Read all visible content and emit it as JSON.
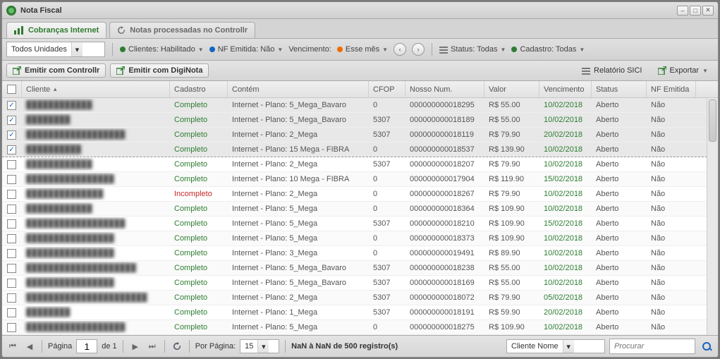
{
  "window": {
    "title": "Nota Fiscal"
  },
  "tabs": {
    "active": "Cobranças Internet",
    "inactive": "Notas processadas no Controllr"
  },
  "filters": {
    "unidade": "Todos Unidades",
    "clientes": "Clientes: Habilitado",
    "nf": "NF Emitida: Não",
    "venc_label": "Vencimento:",
    "venc_value": "Esse mês",
    "status": "Status: Todas",
    "cadastro": "Cadastro: Todas"
  },
  "toolbar": {
    "emitir_controllr": "Emitir com Controllr",
    "emitir_diginota": "Emitir com DigiNota",
    "relatorio": "Relatório SICI",
    "exportar": "Exportar"
  },
  "columns": {
    "cliente": "Cliente",
    "cadastro": "Cadastro",
    "contem": "Contém",
    "cfop": "CFOP",
    "nosso": "Nosso Num.",
    "valor": "Valor",
    "vencimento": "Vencimento",
    "status": "Status",
    "nf": "NF Emitida"
  },
  "rows": [
    {
      "chk": true,
      "cliente": "████████████",
      "cad": "Completo",
      "cad_ok": true,
      "contem": "Internet - Plano: 5_Mega_Bavaro",
      "cfop": "0",
      "num": "000000000018295",
      "valor": "R$ 55.00",
      "venc": "10/02/2018",
      "status": "Aberto",
      "nf": "Não"
    },
    {
      "chk": true,
      "cliente": "████████",
      "cad": "Completo",
      "cad_ok": true,
      "contem": "Internet - Plano: 5_Mega_Bavaro",
      "cfop": "5307",
      "num": "000000000018189",
      "valor": "R$ 55.00",
      "venc": "10/02/2018",
      "status": "Aberto",
      "nf": "Não"
    },
    {
      "chk": true,
      "cliente": "██████████████████",
      "cad": "Completo",
      "cad_ok": true,
      "contem": "Internet - Plano: 2_Mega",
      "cfop": "5307",
      "num": "000000000018119",
      "valor": "R$ 79.90",
      "venc": "20/02/2018",
      "status": "Aberto",
      "nf": "Não"
    },
    {
      "chk": true,
      "cliente": "██████████",
      "cad": "Completo",
      "cad_ok": true,
      "contem": "Internet - Plano: 15 Mega - FIBRA",
      "cfop": "0",
      "num": "000000000018537",
      "valor": "R$ 139.90",
      "venc": "10/02/2018",
      "status": "Aberto",
      "nf": "Não",
      "dashed": true
    },
    {
      "chk": false,
      "cliente": "████████████",
      "cad": "Completo",
      "cad_ok": true,
      "contem": "Internet - Plano: 2_Mega",
      "cfop": "5307",
      "num": "000000000018207",
      "valor": "R$ 79.90",
      "venc": "10/02/2018",
      "status": "Aberto",
      "nf": "Não"
    },
    {
      "chk": false,
      "cliente": "████████████████",
      "cad": "Completo",
      "cad_ok": true,
      "contem": "Internet - Plano: 10 Mega - FIBRA",
      "cfop": "0",
      "num": "000000000017904",
      "valor": "R$ 119.90",
      "venc": "15/02/2018",
      "status": "Aberto",
      "nf": "Não"
    },
    {
      "chk": false,
      "cliente": "██████████████",
      "cad": "Incompleto",
      "cad_ok": false,
      "contem": "Internet - Plano: 2_Mega",
      "cfop": "0",
      "num": "000000000018267",
      "valor": "R$ 79.90",
      "venc": "10/02/2018",
      "status": "Aberto",
      "nf": "Não"
    },
    {
      "chk": false,
      "cliente": "████████████",
      "cad": "Completo",
      "cad_ok": true,
      "contem": "Internet - Plano: 5_Mega",
      "cfop": "0",
      "num": "000000000018364",
      "valor": "R$ 109.90",
      "venc": "10/02/2018",
      "status": "Aberto",
      "nf": "Não"
    },
    {
      "chk": false,
      "cliente": "██████████████████",
      "cad": "Completo",
      "cad_ok": true,
      "contem": "Internet - Plano: 5_Mega",
      "cfop": "5307",
      "num": "000000000018210",
      "valor": "R$ 109.90",
      "venc": "15/02/2018",
      "status": "Aberto",
      "nf": "Não"
    },
    {
      "chk": false,
      "cliente": "████████████████",
      "cad": "Completo",
      "cad_ok": true,
      "contem": "Internet - Plano: 5_Mega",
      "cfop": "0",
      "num": "000000000018373",
      "valor": "R$ 109.90",
      "venc": "10/02/2018",
      "status": "Aberto",
      "nf": "Não"
    },
    {
      "chk": false,
      "cliente": "████████████████",
      "cad": "Completo",
      "cad_ok": true,
      "contem": "Internet - Plano: 3_Mega",
      "cfop": "0",
      "num": "000000000019491",
      "valor": "R$ 89.90",
      "venc": "10/02/2018",
      "status": "Aberto",
      "nf": "Não"
    },
    {
      "chk": false,
      "cliente": "████████████████████",
      "cad": "Completo",
      "cad_ok": true,
      "contem": "Internet - Plano: 5_Mega_Bavaro",
      "cfop": "5307",
      "num": "000000000018238",
      "valor": "R$ 55.00",
      "venc": "10/02/2018",
      "status": "Aberto",
      "nf": "Não"
    },
    {
      "chk": false,
      "cliente": "████████████████",
      "cad": "Completo",
      "cad_ok": true,
      "contem": "Internet - Plano: 5_Mega_Bavaro",
      "cfop": "5307",
      "num": "000000000018169",
      "valor": "R$ 55.00",
      "venc": "10/02/2018",
      "status": "Aberto",
      "nf": "Não"
    },
    {
      "chk": false,
      "cliente": "██████████████████████",
      "cad": "Completo",
      "cad_ok": true,
      "contem": "Internet - Plano: 2_Mega",
      "cfop": "5307",
      "num": "000000000018072",
      "valor": "R$ 79.90",
      "venc": "05/02/2018",
      "status": "Aberto",
      "nf": "Não"
    },
    {
      "chk": false,
      "cliente": "████████",
      "cad": "Completo",
      "cad_ok": true,
      "contem": "Internet - Plano: 1_Mega",
      "cfop": "5307",
      "num": "000000000018191",
      "valor": "R$ 59.90",
      "venc": "20/02/2018",
      "status": "Aberto",
      "nf": "Não"
    },
    {
      "chk": false,
      "cliente": "██████████████████",
      "cad": "Completo",
      "cad_ok": true,
      "contem": "Internet - Plano: 5_Mega",
      "cfop": "0",
      "num": "000000000018275",
      "valor": "R$ 109.90",
      "venc": "10/02/2018",
      "status": "Aberto",
      "nf": "Não"
    }
  ],
  "pager": {
    "pagina_label": "Página",
    "pagina_value": "1",
    "de_label": "de 1",
    "por_pagina_label": "Por Página:",
    "por_pagina_value": "15",
    "count": "NaN à NaN de 500 registro(s)",
    "search_by": "Cliente Nome",
    "search_placeholder": "Procurar"
  }
}
